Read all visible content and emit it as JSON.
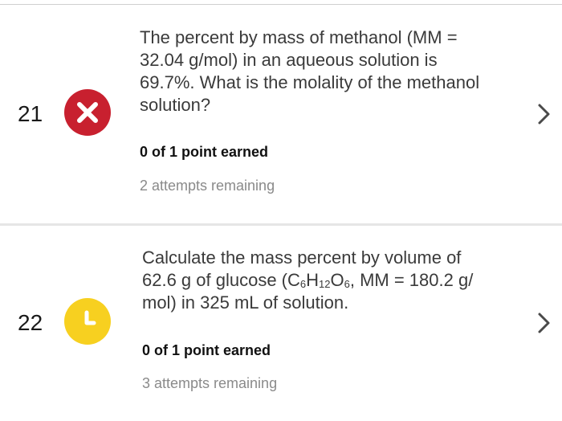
{
  "questions": [
    {
      "number": "21",
      "status_icon": "close-icon",
      "status_color": "#c8202f",
      "prompt_lines": [
        "The percent by mass of methanol (MM =",
        "32.04 g/mol) in an aqueous solution is",
        "69.7%. What is the molality of the methanol",
        "solution?"
      ],
      "points": "0 of 1 point earned",
      "attempts": "2 attempts remaining"
    },
    {
      "number": "22",
      "status_icon": "clock-icon",
      "status_color": "#f7d020",
      "prompt_line1": "Calculate the mass percent by volume of",
      "prompt_line2_prefix": "62.6 g of glucose (C",
      "prompt_line2_c_sub": "6",
      "prompt_line2_h": "H",
      "prompt_line2_h_sub": "12",
      "prompt_line2_o": "O",
      "prompt_line2_o_sub": "6",
      "prompt_line2_suffix": ", MM = 180.2 g/",
      "prompt_line3": "mol) in 325 mL of solution.",
      "points": "0 of 1 point earned",
      "attempts": "3 attempts remaining"
    }
  ]
}
